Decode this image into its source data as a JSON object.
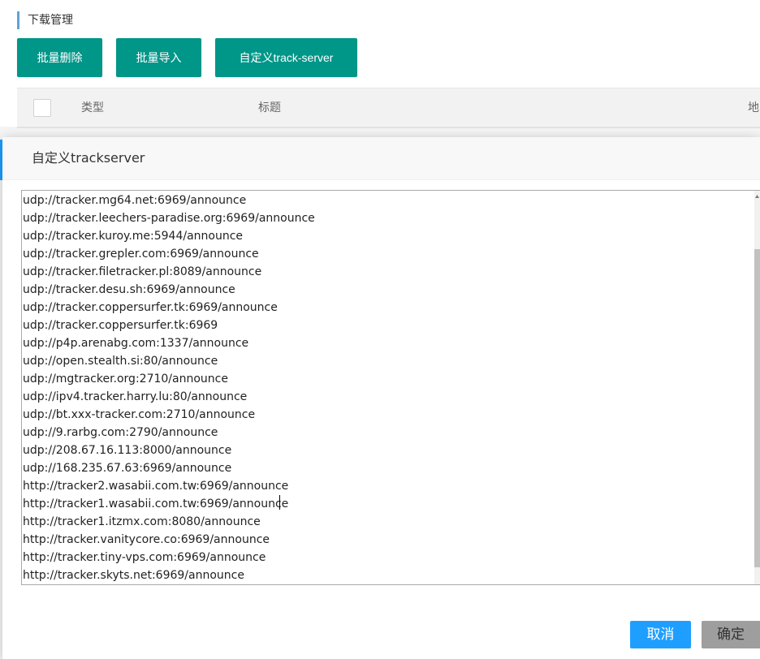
{
  "page": {
    "section_title": "下载管理"
  },
  "toolbar": {
    "batch_delete_label": "批量删除",
    "batch_import_label": "批量导入",
    "custom_tracker_label": "自定义track-server"
  },
  "table": {
    "columns": [
      "类型",
      "标题",
      "地"
    ]
  },
  "dialog": {
    "title": "自定义trackserver",
    "trackers": [
      "udp://tracker.mg64.net:6969/announce",
      "udp://tracker.leechers-paradise.org:6969/announce",
      "udp://tracker.kuroy.me:5944/announce",
      "udp://tracker.grepler.com:6969/announce",
      "udp://tracker.filetracker.pl:8089/announce",
      "udp://tracker.desu.sh:6969/announce",
      "udp://tracker.coppersurfer.tk:6969/announce",
      "udp://tracker.coppersurfer.tk:6969",
      "udp://p4p.arenabg.com:1337/announce",
      "udp://open.stealth.si:80/announce",
      "udp://mgtracker.org:2710/announce",
      "udp://ipv4.tracker.harry.lu:80/announce",
      "udp://bt.xxx-tracker.com:2710/announce",
      "udp://9.rarbg.com:2790/announce",
      "udp://208.67.16.113:8000/announce",
      "udp://168.235.67.63:6969/announce",
      "http://tracker2.wasabii.com.tw:6969/announce",
      "http://tracker1.wasabii.com.tw:6969/announce",
      "http://tracker1.itzmx.com:8080/announce",
      "http://tracker.vanitycore.co:6969/announce",
      "http://tracker.tiny-vps.com:6969/announce",
      "http://tracker.skyts.net:6969/announce"
    ],
    "cancel_label": "取消",
    "confirm_label": "确定"
  },
  "colors": {
    "primary_green": "#009688",
    "primary_blue": "#1e9fff",
    "disabled_gray": "#9e9e9e"
  },
  "icons": {
    "scroll_up": "triangle-up-icon"
  }
}
